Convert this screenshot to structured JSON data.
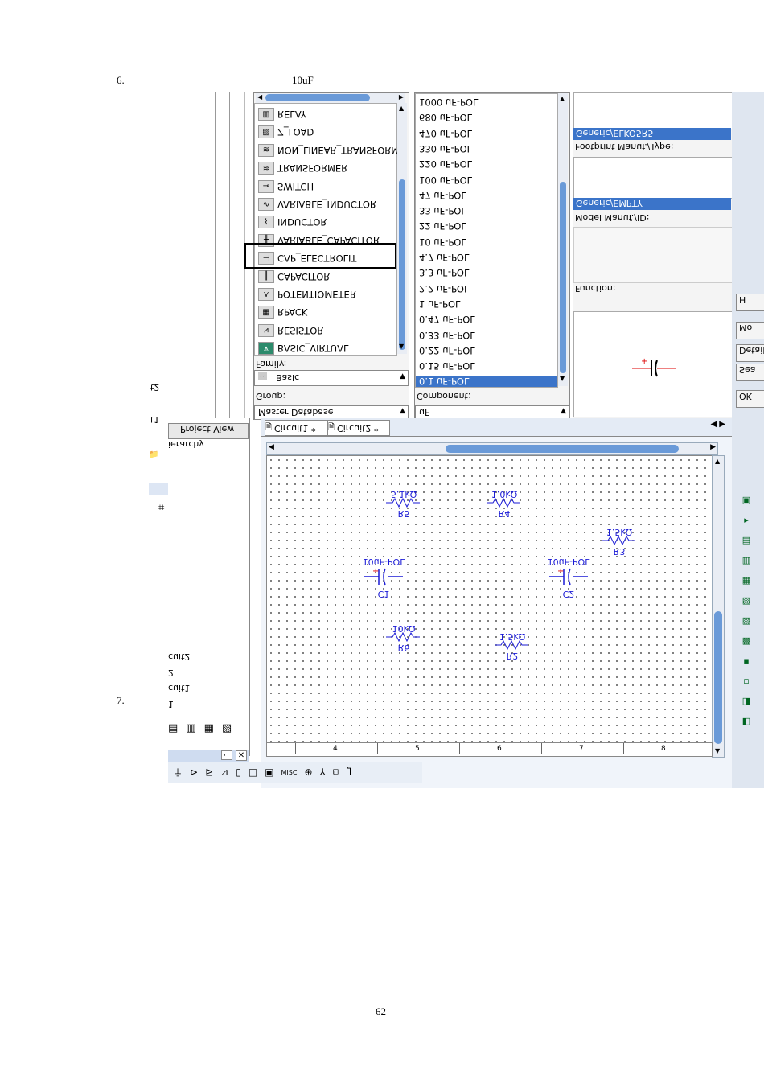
{
  "doc": {
    "step6_number": "6.",
    "step6_text": "10uF",
    "step7_number": "7.",
    "page_number": "62"
  },
  "family_panel": {
    "label": "Family:",
    "items": [
      {
        "name": "RELAY",
        "icon": "relay-icon"
      },
      {
        "name": "Z_LOAD",
        "icon": "zload-icon"
      },
      {
        "name": "NON_LINEAR_TRANSFORM",
        "icon": "transformer-icon"
      },
      {
        "name": "TRANSFORMER",
        "icon": "transformer-icon"
      },
      {
        "name": "SWITCH",
        "icon": "switch-icon"
      },
      {
        "name": "VARIABLE_INDUCTOR",
        "icon": "variable-inductor-icon"
      },
      {
        "name": "INDUCTOR",
        "icon": "inductor-icon"
      },
      {
        "name": "VARIABLE_CAPACITOR",
        "icon": "variable-capacitor-icon"
      },
      {
        "name": "CAP_ELECTROLIT",
        "icon": "electrolytic-capacitor-icon"
      },
      {
        "name": "CAPACITOR",
        "icon": "capacitor-icon"
      },
      {
        "name": "POTENTIOMETER",
        "icon": "potentiometer-icon"
      },
      {
        "name": "RPACK",
        "icon": "rpack-icon"
      },
      {
        "name": "RESISTOR",
        "icon": "resistor-icon"
      },
      {
        "name": "BASIC_VIRTUAL",
        "icon": "basic-virtual-icon"
      }
    ],
    "highlighted": "CAP_ELECTROLIT"
  },
  "group": {
    "label": "Group:",
    "value": "Basic"
  },
  "database": {
    "label": "Master Database"
  },
  "component_panel": {
    "label": "Component:",
    "search_value": "uF",
    "items": [
      "1000 uF-POL",
      "680 uF-POL",
      "470 uF-POL",
      "330 uF-POL",
      "220 uF-POL",
      "100 uF-POL",
      "47 uF-POL",
      "33 uF-POL",
      "22 uF-POL",
      "10 uF-POL",
      "4.7 uF-POL",
      "3.3 uF-POL",
      "2.2 uF-POL",
      "1 uF-POL",
      "0.47 uF-POL",
      "0.33 uF-POL",
      "0.22 uF-POL",
      "0.15 uF-POL",
      "0.1 uF-POL"
    ],
    "selected": "0.1 uF-POL"
  },
  "info_panel": {
    "footprint_label": "Footprint Manuf./Type:",
    "footprint_value": "Generic/ELKO5R5",
    "model_label": "Model Manuf./ID:",
    "model_value": "Generic/EMPTY",
    "function_label": "Function:"
  },
  "side_buttons": [
    "H",
    "Mo",
    "Detail",
    "Sea",
    "OK"
  ],
  "design_toolbox": {
    "tab_project_view": "Project View",
    "hierarchy_label": "ierarchy",
    "tree_items": [
      "cuit2",
      "2",
      "cuit1",
      "1"
    ],
    "fragments": [
      "t2",
      "t1"
    ]
  },
  "tabs": [
    {
      "label": "Circuit1 *"
    },
    {
      "label": "Circuit2 *"
    }
  ],
  "schematic": {
    "components": [
      {
        "ref": "R5",
        "value": "5.1kΩ",
        "type": "resistor"
      },
      {
        "ref": "R4",
        "value": "1.0kΩ",
        "type": "resistor"
      },
      {
        "ref": "R3",
        "value": "1.5kΩ",
        "type": "resistor"
      },
      {
        "ref": "C1",
        "value": "10uF-POL",
        "type": "cap"
      },
      {
        "ref": "C2",
        "value": "10uF-POL",
        "type": "cap"
      },
      {
        "ref": "R6",
        "value": "10kΩ",
        "type": "resistor"
      },
      {
        "ref": "R2",
        "value": "1.5kΩ",
        "type": "resistor"
      }
    ],
    "ruler": [
      "4",
      "5",
      "6",
      "7",
      "8"
    ]
  },
  "bottom_toolbar": {
    "misc_label": "MISC"
  }
}
